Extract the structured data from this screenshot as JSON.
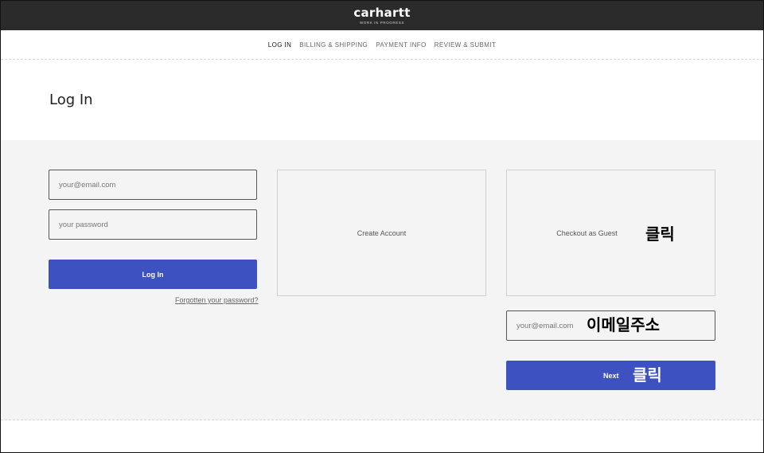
{
  "header": {
    "logo": "carhartt",
    "tagline": "WORK IN PROGRESS"
  },
  "steps": {
    "items": [
      "LOG IN",
      "BILLING & SHIPPING",
      "PAYMENT INFO",
      "REVIEW & SUBMIT"
    ],
    "active_index": 0
  },
  "page": {
    "title": "Log In"
  },
  "login": {
    "email_placeholder": "your@email.com",
    "password_placeholder": "your password",
    "login_button": "Log In",
    "forgot_link": "Forgotten your password?"
  },
  "create_account": {
    "label": "Create Account"
  },
  "guest": {
    "label": "Checkout as Guest",
    "email_placeholder": "your@email.com",
    "next_button": "Next"
  },
  "annotations": {
    "guest_click": "클릭",
    "email_hint": "이메일주소",
    "next_click": "클릭"
  },
  "colors": {
    "header_bg": "#2b2b2b",
    "primary": "#3d52c0",
    "section_bg": "#f4f4f4"
  }
}
